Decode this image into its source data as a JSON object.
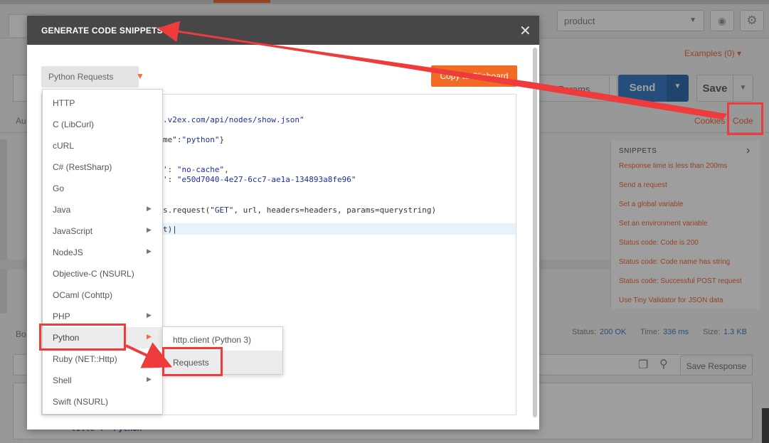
{
  "background": {
    "environment": "product",
    "examples_label": "Examples (0)",
    "params_label": "Params",
    "send_label": "Send",
    "save_label": "Save",
    "auth_tab": "Au",
    "cookies_label": "Cookies",
    "code_label": "Code",
    "snippets": {
      "heading": "SNIPPETS",
      "items": [
        "Response time is less than 200ms",
        "Send a request",
        "Set a global variable",
        "Set an environment variable",
        "Status code: Code is 200",
        "Status code: Code name has string",
        "Status code: Successful POST request",
        "Use Tiny Validator for JSON data"
      ]
    },
    "body_tab": "Bo",
    "status_label": "Status:",
    "status_value": "200 OK",
    "time_label": "Time:",
    "time_value": "336 ms",
    "size_label": "Size:",
    "size_value": "1.3 KB",
    "save_response_label": "Save Response",
    "response_peek_key": "title",
    "response_peek_value": "Python"
  },
  "modal": {
    "title": "GENERATE CODE SNIPPETS",
    "selected_language": "Python Requests",
    "copy_button": "Copy to Clipboard",
    "code_lines": [
      {
        "prefix": "",
        "str": ".v2ex.com/api/nodes/show.json\"",
        "suffix": ""
      },
      {
        "prefix": "me\":",
        "str": "\"python\"",
        "suffix": "}"
      },
      {
        "prefix": "': ",
        "str": "\"no-cache\"",
        "suffix": ","
      },
      {
        "prefix": "': ",
        "str": "\"e50d7040-4e27-6cc7-ae1a-134893a8fe96\"",
        "suffix": ""
      },
      {
        "prefix": "s.request(",
        "str": "\"GET\"",
        "suffix": ", url, headers=headers, params=querystring)"
      },
      {
        "prefix": "t)",
        "str": "",
        "suffix": ""
      }
    ],
    "languages": [
      {
        "label": "HTTP",
        "submenu": false
      },
      {
        "label": "C (LibCurl)",
        "submenu": false
      },
      {
        "label": "cURL",
        "submenu": false
      },
      {
        "label": "C# (RestSharp)",
        "submenu": false
      },
      {
        "label": "Go",
        "submenu": false
      },
      {
        "label": "Java",
        "submenu": true
      },
      {
        "label": "JavaScript",
        "submenu": true
      },
      {
        "label": "NodeJS",
        "submenu": true
      },
      {
        "label": "Objective-C (NSURL)",
        "submenu": false
      },
      {
        "label": "OCaml (Cohttp)",
        "submenu": false
      },
      {
        "label": "PHP",
        "submenu": true
      },
      {
        "label": "Python",
        "submenu": true
      },
      {
        "label": "Ruby (NET::Http)",
        "submenu": false
      },
      {
        "label": "Shell",
        "submenu": true
      },
      {
        "label": "Swift (NSURL)",
        "submenu": false
      }
    ],
    "python_variants": [
      "http.client (Python 3)",
      "Requests"
    ]
  },
  "colors": {
    "accent": "#f26b3a",
    "send": "#3d7fca",
    "annotation": "#ee3b3b",
    "modal_header": "#474747"
  }
}
